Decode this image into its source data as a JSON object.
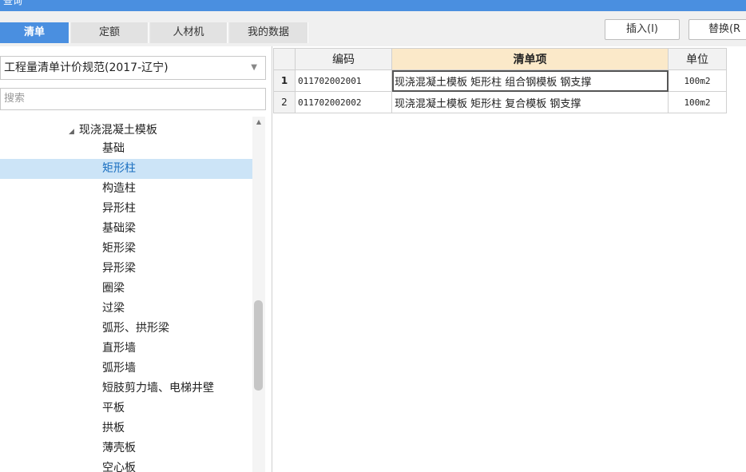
{
  "window": {
    "title": "查询"
  },
  "tabs": [
    {
      "label": "清单",
      "active": true
    },
    {
      "label": "定额",
      "active": false
    },
    {
      "label": "人材机",
      "active": false
    },
    {
      "label": "我的数据",
      "active": false
    }
  ],
  "toolbar": {
    "insert_label": "插入(I)",
    "replace_label": "替换(R"
  },
  "left": {
    "spec_selected": "工程量清单计价规范(2017-辽宁)",
    "search_placeholder": "搜索",
    "tree_parent": "现浇混凝土模板",
    "tree_items": [
      "基础",
      "矩形柱",
      "构造柱",
      "异形柱",
      "基础梁",
      "矩形梁",
      "异形梁",
      "圈梁",
      "过梁",
      "弧形、拱形梁",
      "直形墙",
      "弧形墙",
      "短肢剪力墙、电梯井壁",
      "平板",
      "拱板",
      "薄壳板",
      "空心板"
    ],
    "selected_item": "矩形柱"
  },
  "table": {
    "headers": [
      "编码",
      "清单项",
      "单位"
    ],
    "rows": [
      {
        "num": "1",
        "code": "011702002001",
        "item": "现浇混凝土模板 矩形柱 组合钢模板 钢支撑",
        "unit": "100m2"
      },
      {
        "num": "2",
        "code": "011702002002",
        "item": "现浇混凝土模板 矩形柱 复合模板 钢支撑",
        "unit": "100m2"
      }
    ]
  },
  "colors": {
    "accent": "#4a8fe0",
    "selection": "#cce4f7",
    "header_highlight": "#fbe9c9"
  }
}
